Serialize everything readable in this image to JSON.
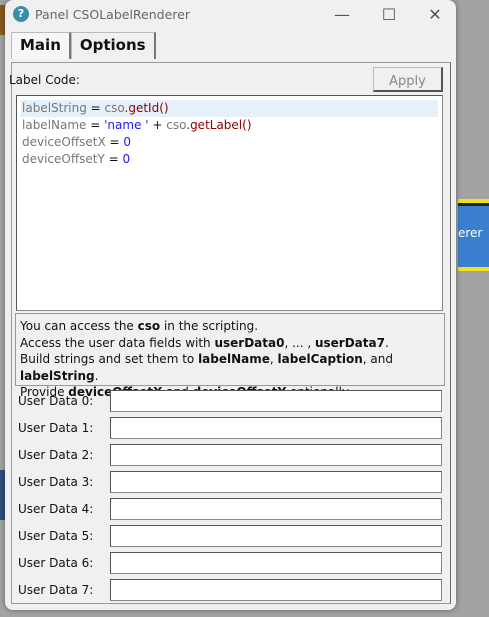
{
  "window": {
    "title": "Panel CSOLabelRenderer",
    "minimize": "—",
    "maximize": "☐",
    "close": "✕"
  },
  "background": {
    "button_fragment": "erer"
  },
  "tabs": [
    {
      "label": "Main"
    },
    {
      "label": "Options"
    }
  ],
  "main": {
    "label_code": "Label Code:",
    "apply_label": "Apply",
    "code": [
      [
        {
          "t": "labelString",
          "c": "v"
        },
        {
          "t": " = ",
          "c": ""
        },
        {
          "t": "cso",
          "c": "v"
        },
        {
          "t": ".getId()",
          "c": "f"
        }
      ],
      [
        {
          "t": "labelName",
          "c": "v"
        },
        {
          "t": " = ",
          "c": ""
        },
        {
          "t": "'name '",
          "c": "s"
        },
        {
          "t": " + ",
          "c": ""
        },
        {
          "t": "cso",
          "c": "v"
        },
        {
          "t": ".getLabel()",
          "c": "f"
        }
      ],
      [
        {
          "t": "deviceOffsetX",
          "c": "v"
        },
        {
          "t": " = ",
          "c": ""
        },
        {
          "t": "0",
          "c": "n"
        }
      ],
      [
        {
          "t": "deviceOffsetY",
          "c": "v"
        },
        {
          "t": " = ",
          "c": ""
        },
        {
          "t": "0",
          "c": "n"
        }
      ]
    ],
    "info": [
      [
        {
          "t": "You can access the "
        },
        {
          "t": "cso",
          "b": true
        },
        {
          "t": " in the scripting."
        }
      ],
      [
        {
          "t": "Access the user data fields with "
        },
        {
          "t": "userData0",
          "b": true
        },
        {
          "t": ", ... , "
        },
        {
          "t": "userData7",
          "b": true
        },
        {
          "t": "."
        }
      ],
      [
        {
          "t": "Build strings and set them to "
        },
        {
          "t": "labelName",
          "b": true
        },
        {
          "t": ", "
        },
        {
          "t": "labelCaption",
          "b": true
        },
        {
          "t": ", and "
        },
        {
          "t": "labelString",
          "b": true
        },
        {
          "t": "."
        }
      ],
      [
        {
          "t": "Provide "
        },
        {
          "t": "deviceOffsetX",
          "b": true
        },
        {
          "t": " and "
        },
        {
          "t": "deviceOffsetY",
          "b": true
        },
        {
          "t": " optionally."
        }
      ]
    ],
    "user_data": [
      {
        "label": "User Data 0:",
        "value": ""
      },
      {
        "label": "User Data 1:",
        "value": ""
      },
      {
        "label": "User Data 2:",
        "value": ""
      },
      {
        "label": "User Data 3:",
        "value": ""
      },
      {
        "label": "User Data 4:",
        "value": ""
      },
      {
        "label": "User Data 5:",
        "value": ""
      },
      {
        "label": "User Data 6:",
        "value": ""
      },
      {
        "label": "User Data 7:",
        "value": ""
      }
    ]
  }
}
